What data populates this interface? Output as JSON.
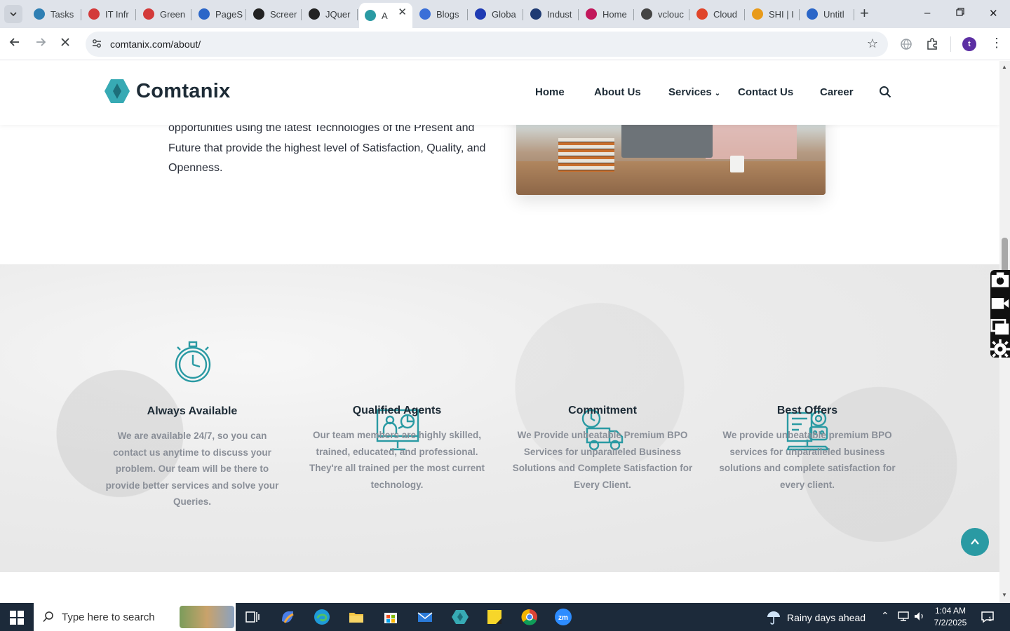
{
  "browser": {
    "tabs": [
      {
        "label": "Tasks",
        "icon": "compass-tab-icon",
        "color": "#2f7fb3"
      },
      {
        "label": "IT Infr",
        "icon": "diamond-tab-icon",
        "color": "#d33a3a"
      },
      {
        "label": "Green",
        "icon": "diamond-tab-icon",
        "color": "#d33a3a"
      },
      {
        "label": "PageS",
        "icon": "speed-tab-icon",
        "color": "#2b66c8"
      },
      {
        "label": "Screer",
        "icon": "gear-tab-icon",
        "color": "#222222"
      },
      {
        "label": "JQuer",
        "icon": "openai-tab-icon",
        "color": "#222222"
      },
      {
        "label": "A",
        "icon": "comtanix-tab-icon",
        "color": "#2a9aa3",
        "active": true
      },
      {
        "label": "Blogs",
        "icon": "scale-tab-icon",
        "color": "#3a6fd8"
      },
      {
        "label": "Globa",
        "icon": "x-tab-icon",
        "color": "#1f3bb3"
      },
      {
        "label": "Indust",
        "icon": "check-tab-icon",
        "color": "#1f3b73"
      },
      {
        "label": "Home",
        "icon": "app-tab-icon",
        "color": "#c2185b"
      },
      {
        "label": "vclouc",
        "icon": "globe-tab-icon",
        "color": "#444444"
      },
      {
        "label": "Cloud",
        "icon": "slash-tab-icon",
        "color": "#e0452a"
      },
      {
        "label": "SHI | I",
        "icon": "ring-tab-icon",
        "color": "#e89a1a"
      },
      {
        "label": "Untitl",
        "icon": "doc-tab-icon",
        "color": "#2b66c8"
      }
    ],
    "url": "comtanix.com/about/",
    "profile_initial": "t"
  },
  "site": {
    "brand": "Comtanix",
    "nav": [
      "Home",
      "About Us",
      "Services",
      "Contact Us",
      "Career"
    ],
    "about_text": "opportunities using the latest Technologies of the Present and Future that provide the highest level of Satisfaction, Quality, and Openness.",
    "accent": "#2a9aa3",
    "features": [
      {
        "title": "Always Available",
        "icon": "stopwatch-icon",
        "text": "We are available 24/7, so you can contact us anytime to discuss your problem. Our team will be there to provide better services and solve your Queries."
      },
      {
        "title": "Qualified Agents",
        "icon": "presentation-icon",
        "text": "Our team members are highly skilled, trained, educated, and professional. They're all trained per the most current technology."
      },
      {
        "title": "Commitment",
        "icon": "delivery-truck-icon",
        "text": "We Provide unbeatable Premium BPO Services for unparalleled Business Solutions and Complete Satisfaction for Every Client."
      },
      {
        "title": "Best Offers",
        "icon": "offer-robot-icon",
        "text": "We provide unbeatable premium BPO services for unparalleled business solutions and complete satisfaction for every client."
      }
    ]
  },
  "taskbar": {
    "search_placeholder": "Type here to search",
    "weather": "Rainy days ahead",
    "time": "1:04 AM",
    "date": "7/2/2025",
    "notifications": "1"
  }
}
